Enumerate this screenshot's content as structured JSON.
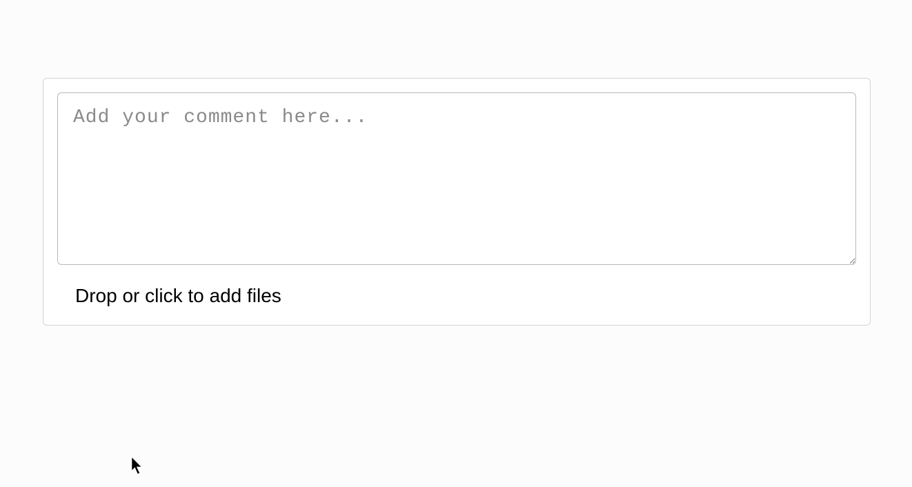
{
  "comment": {
    "placeholder": "Add your comment here...",
    "value": ""
  },
  "dropzone": {
    "label": "Drop or click to add files"
  }
}
